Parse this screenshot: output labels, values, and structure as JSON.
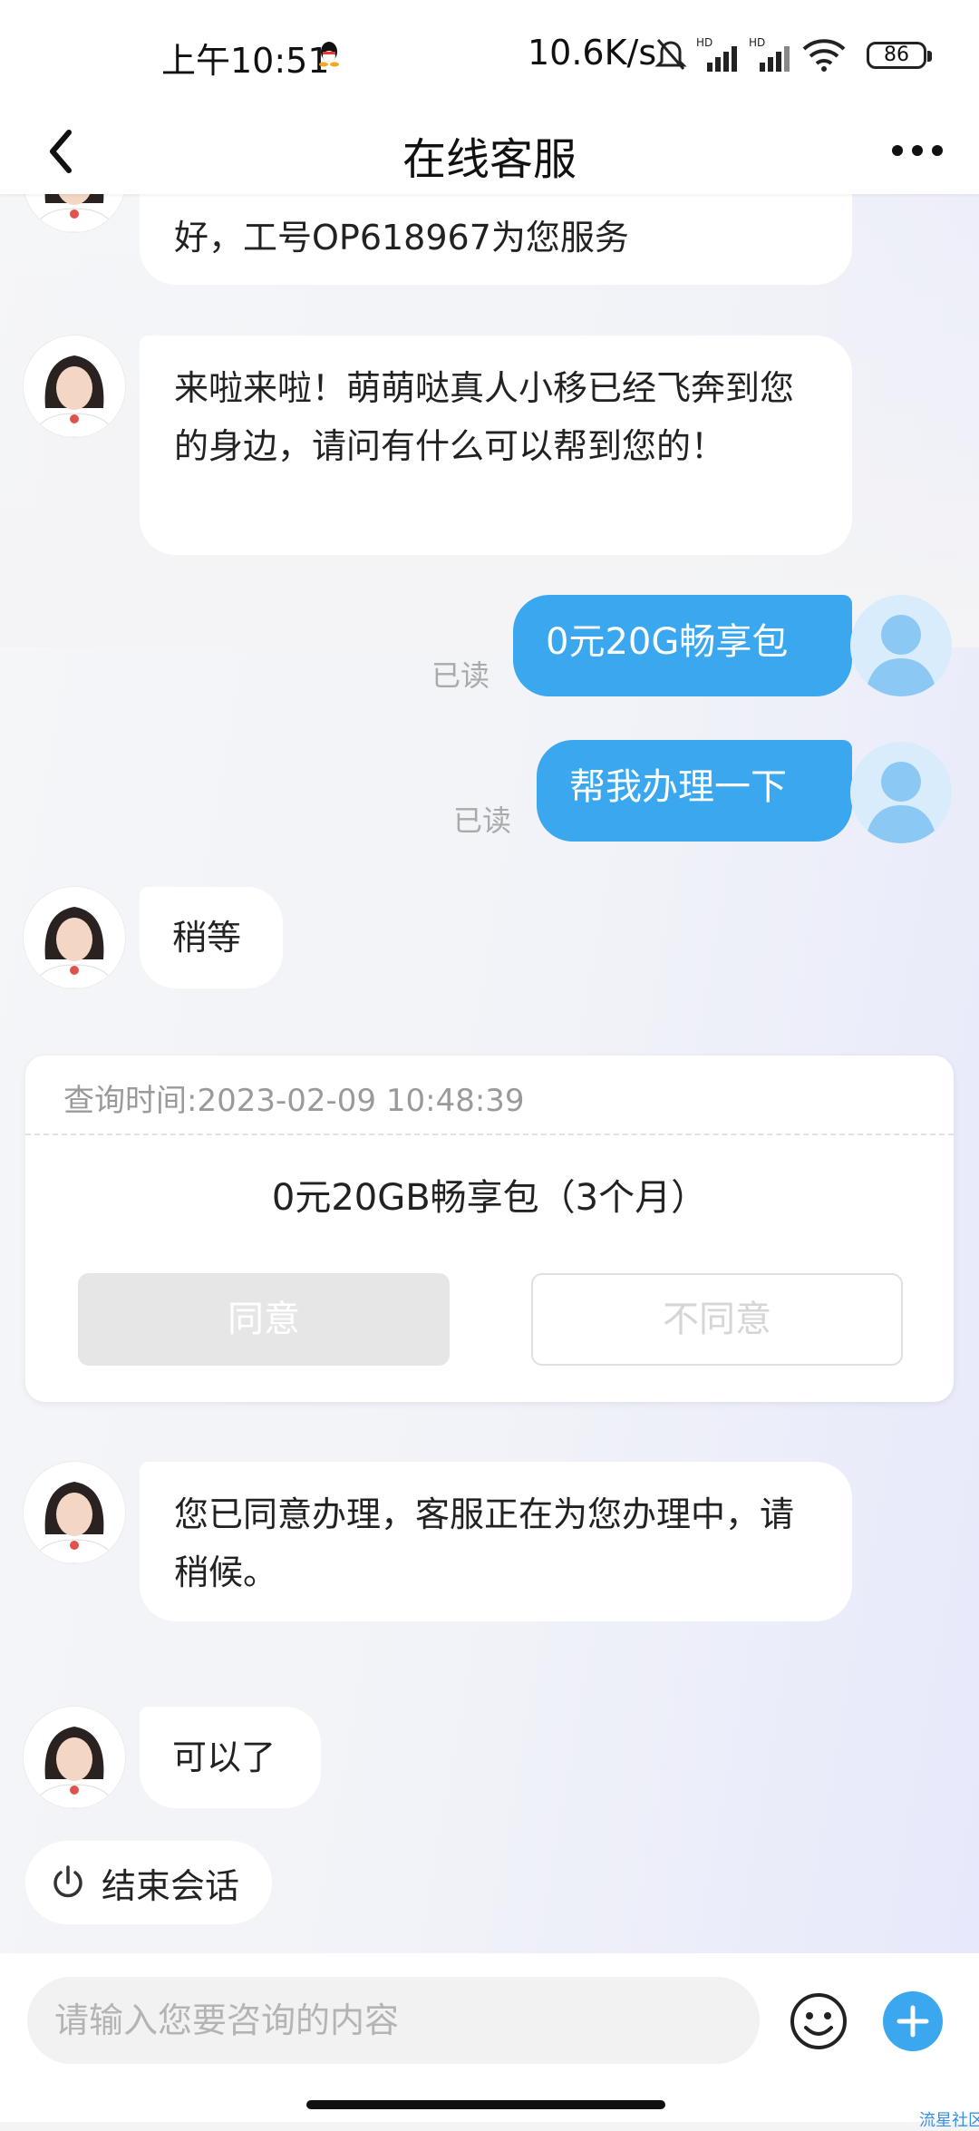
{
  "status_bar": {
    "time": "上午10:51",
    "net_speed": "10.6K/s",
    "battery": "86",
    "icons": [
      "qq-icon",
      "mute-bell-icon",
      "hd-signal-icon",
      "hd-signal-icon",
      "wifi-icon",
      "battery-icon"
    ]
  },
  "nav": {
    "title": "在线客服",
    "back_icon": "chevron-left-icon",
    "more_icon": "more-dots-icon"
  },
  "messages": [
    {
      "from": "agent",
      "text": "好，工号OP618967为您服务"
    },
    {
      "from": "agent",
      "text": "来啦来啦！萌萌哒真人小移已经飞奔到您的身边，请问有什么可以帮到您的！"
    },
    {
      "from": "user",
      "text": "0元20G畅享包",
      "status": "已读"
    },
    {
      "from": "user",
      "text": "帮我办理一下",
      "status": "已读"
    },
    {
      "from": "agent",
      "text": "稍等"
    },
    {
      "from": "agent",
      "text": "您已同意办理，客服正在为您办理中，请稍候。"
    },
    {
      "from": "agent",
      "text": "可以了"
    }
  ],
  "confirm_card": {
    "query_time": "查询时间:2023-02-09 10:48:39",
    "product": "0元20GB畅享包（3个月）",
    "agree_label": "同意",
    "disagree_label": "不同意"
  },
  "end_session": {
    "label": "结束会话",
    "icon": "power-icon"
  },
  "input": {
    "placeholder": "请输入您要咨询的内容",
    "value": "",
    "emoji_icon": "emoji-icon",
    "plus_icon": "plus-icon"
  },
  "watermark": "流星社区",
  "colors": {
    "accent": "#3aa7ef",
    "user_bubble": "#3aa7ef",
    "agent_bubble": "#ffffff",
    "background": "#f4f4f6",
    "plus_button": "#3aa7ef"
  }
}
